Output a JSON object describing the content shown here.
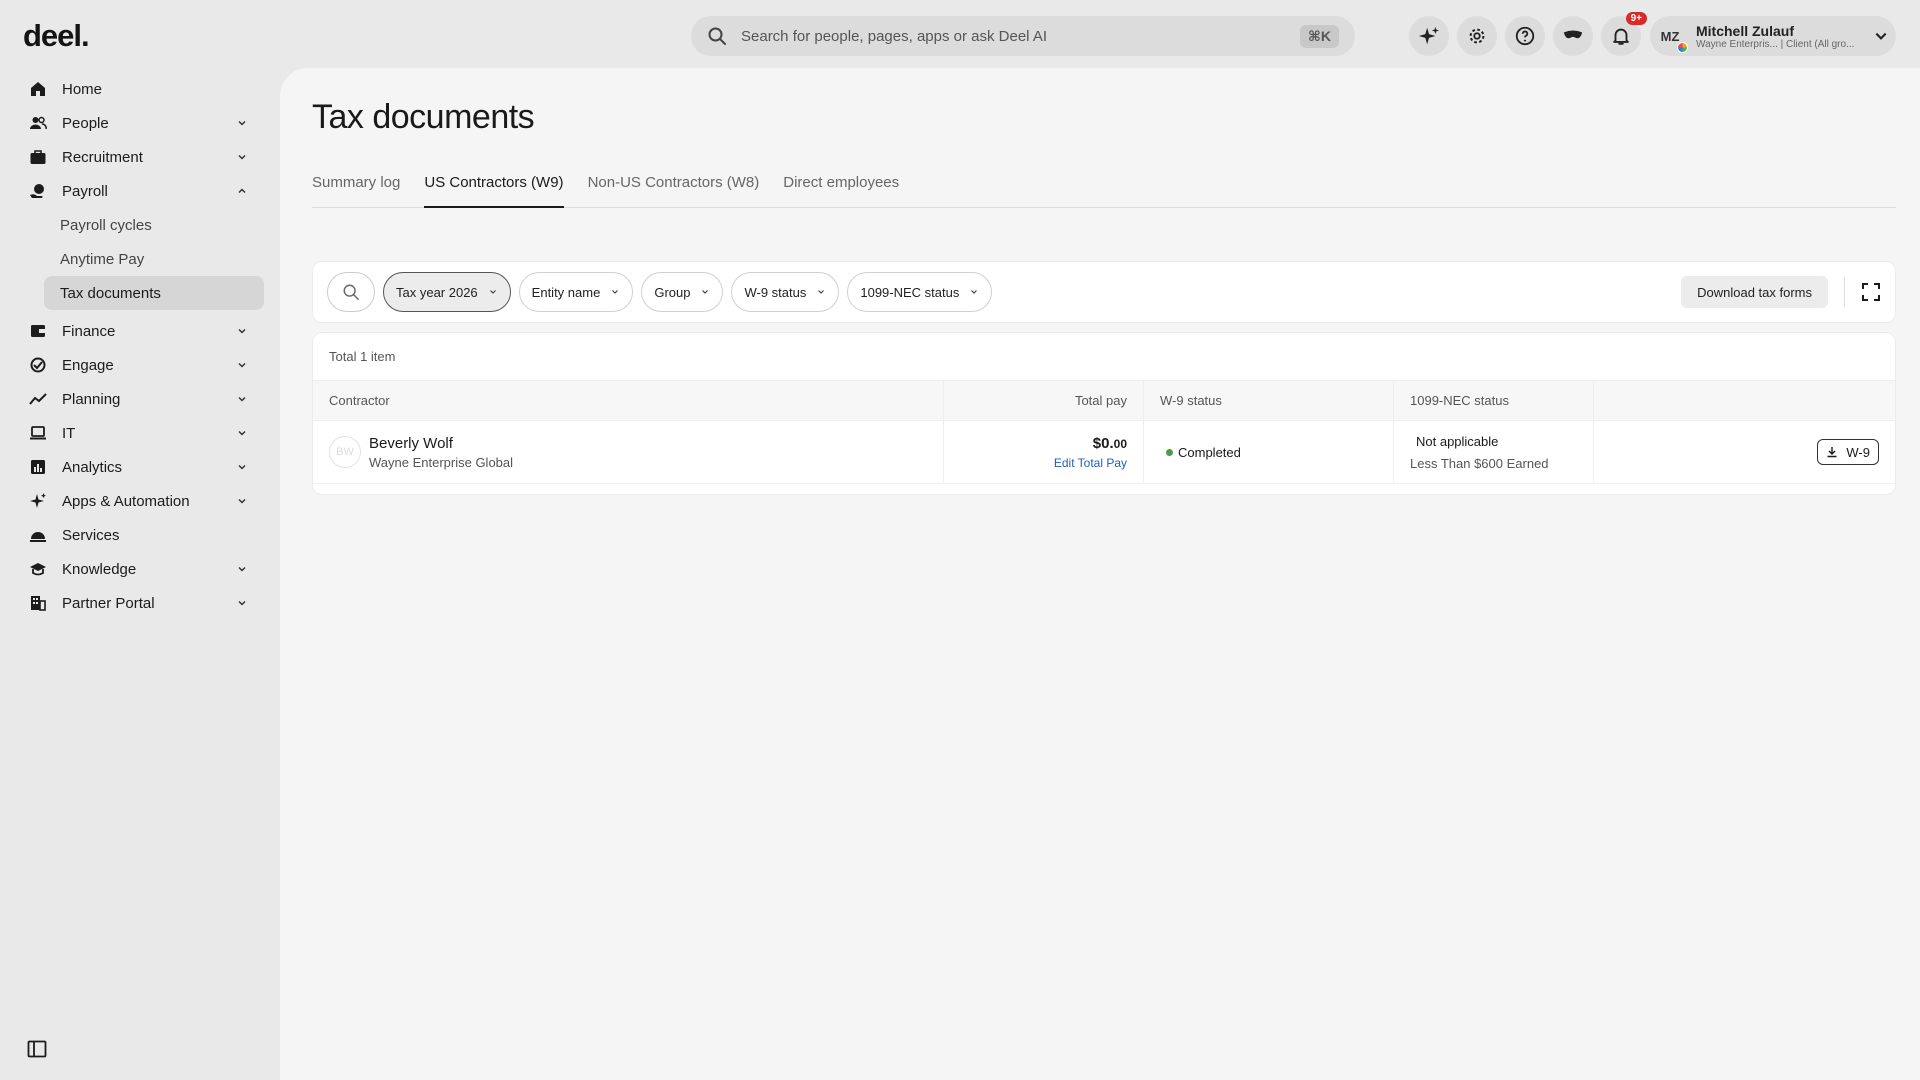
{
  "app": {
    "logo": "deel."
  },
  "search": {
    "placeholder": "Search for people, pages, apps or ask Deel AI",
    "shortcut": "⌘K"
  },
  "notifications": {
    "badge": "9+"
  },
  "user": {
    "initials": "MZ",
    "name": "Mitchell Zulauf",
    "subtitle": "Wayne Enterpris... | Client (All gro..."
  },
  "sidebar": {
    "items": [
      {
        "label": "Home",
        "icon": "home-icon"
      },
      {
        "label": "People",
        "icon": "people-icon"
      },
      {
        "label": "Recruitment",
        "icon": "briefcase-icon"
      },
      {
        "label": "Payroll",
        "icon": "payroll-icon"
      },
      {
        "label": "Finance",
        "icon": "wallet-icon"
      },
      {
        "label": "Engage",
        "icon": "engage-icon"
      },
      {
        "label": "Planning",
        "icon": "trend-icon"
      },
      {
        "label": "IT",
        "icon": "laptop-icon"
      },
      {
        "label": "Analytics",
        "icon": "bar-chart-icon"
      },
      {
        "label": "Apps & Automation",
        "icon": "sparkle-icon"
      },
      {
        "label": "Services",
        "icon": "bell-service-icon"
      },
      {
        "label": "Knowledge",
        "icon": "graduation-cap-icon"
      },
      {
        "label": "Partner Portal",
        "icon": "building-icon"
      }
    ],
    "payroll_sub": [
      "Payroll cycles",
      "Anytime Pay",
      "Tax documents"
    ]
  },
  "page": {
    "title": "Tax documents",
    "tabs": [
      "Summary log",
      "US Contractors (W9)",
      "Non-US Contractors (W8)",
      "Direct employees"
    ]
  },
  "filters": {
    "chips": [
      "Tax year 2026",
      "Entity name",
      "Group",
      "W-9 status",
      "1099-NEC status"
    ],
    "download_label": "Download tax forms"
  },
  "table": {
    "total_label": "Total 1 item",
    "headers": [
      "Contractor",
      "Total pay",
      "W-9 status",
      "1099-NEC status"
    ],
    "rows": [
      {
        "initials": "BW",
        "name": "Beverly Wolf",
        "entity": "Wayne Enterprise Global",
        "pay_main": "$0.",
        "pay_cents": "00",
        "edit_label": "Edit Total Pay",
        "w9_status": "Completed",
        "nec_status": "Not applicable",
        "nec_note": "Less Than $600 Earned",
        "action_label": "W-9"
      }
    ]
  }
}
